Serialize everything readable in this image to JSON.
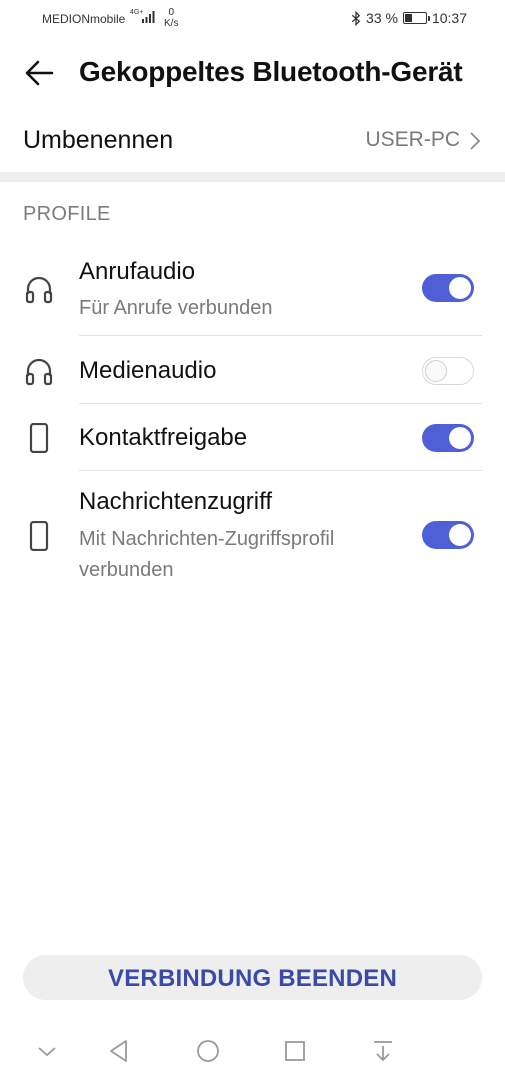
{
  "status_bar": {
    "carrier": "MEDIONmobile",
    "network": "4G+",
    "speed_value": "0",
    "speed_unit": "K/s",
    "battery_percent": "33 %",
    "battery_level": 0.33,
    "time": "10:37"
  },
  "header": {
    "title": "Gekoppeltes Bluetooth-Gerät"
  },
  "rename": {
    "label": "Umbenennen",
    "value": "USER-PC"
  },
  "profiles": {
    "section_title": "PROFILE",
    "items": [
      {
        "label": "Anrufaudio",
        "sublabel": "Für Anrufe verbunden",
        "icon": "headphones-icon",
        "enabled": true
      },
      {
        "label": "Medienaudio",
        "icon": "headphones-icon",
        "enabled": false
      },
      {
        "label": "Kontaktfreigabe",
        "icon": "phone-icon",
        "enabled": true
      },
      {
        "label": "Nachrichtenzugriff",
        "sublabel": "Mit Nachrichten-Zugriffsprofil verbunden",
        "icon": "phone-icon",
        "enabled": true
      }
    ]
  },
  "actions": {
    "disconnect_label": "VERBINDUNG BEENDEN"
  },
  "colors": {
    "accent": "#4f5fd6",
    "button_text": "#3b4aa6",
    "secondary_text": "#7a7a7a"
  }
}
